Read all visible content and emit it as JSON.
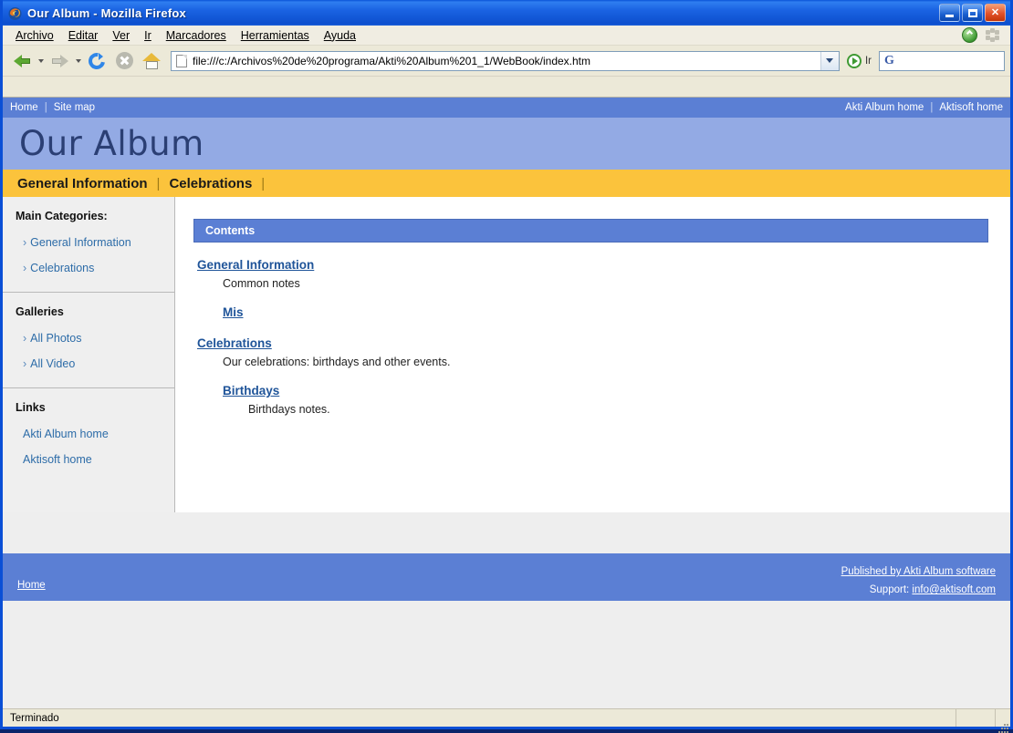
{
  "browser": {
    "title": "Our Album - Mozilla Firefox",
    "app_icon": "firefox-icon",
    "window_buttons": {
      "minimize": "minimize-button",
      "maximize": "maximize-button",
      "close": "close-button"
    },
    "menu": [
      "Archivo",
      "Editar",
      "Ver",
      "Ir",
      "Marcadores",
      "Herramientas",
      "Ayuda"
    ],
    "toolbar": {
      "back": "back-button",
      "forward": "forward-button",
      "reload": "reload-button",
      "stop": "stop-button",
      "home": "home-button",
      "url": "file:///c:/Archivos%20de%20programa/Akti%20Album%201_1/WebBook/index.htm",
      "go_label": "Ir",
      "search_logo": "G",
      "search_value": ""
    },
    "status": "Terminado"
  },
  "page": {
    "topnav": {
      "left": [
        {
          "label": "Home"
        },
        {
          "label": "Site map"
        }
      ],
      "right": [
        {
          "label": "Akti Album home"
        },
        {
          "label": "Aktisoft home"
        }
      ],
      "separator": "|"
    },
    "banner_title": "Our Album",
    "tabs": [
      {
        "label": "General Information"
      },
      {
        "label": "Celebrations"
      }
    ],
    "tab_separator": "|",
    "sidebar": {
      "blocks": [
        {
          "title": "Main Categories:",
          "items": [
            {
              "label": "General Information",
              "chevron": "›"
            },
            {
              "label": "Celebrations",
              "chevron": "›"
            }
          ]
        },
        {
          "title": "Galleries",
          "items": [
            {
              "label": "All Photos",
              "chevron": "›"
            },
            {
              "label": "All Video",
              "chevron": "›"
            }
          ]
        },
        {
          "title": "Links",
          "items": [
            {
              "label": "Akti Album home",
              "chevron": ""
            },
            {
              "label": "Aktisoft home",
              "chevron": ""
            }
          ]
        }
      ]
    },
    "contents": {
      "header": "Contents",
      "entries": [
        {
          "link": "General Information",
          "note": "Common notes",
          "children": [
            {
              "link": "Mis",
              "note": ""
            }
          ]
        },
        {
          "link": "Celebrations",
          "note": "Our celebrations: birthdays and other events.",
          "children": [
            {
              "link": "Birthdays",
              "note": "Birthdays notes."
            }
          ]
        }
      ]
    },
    "footer": {
      "home": "Home",
      "published": "Published by Akti Album software",
      "support_label": "Support:",
      "support_email": "info@aktisoft.com"
    }
  },
  "colors": {
    "titlebar": "#1a63e2",
    "page_blue": "#5b7fd4",
    "banner_blue": "#93aae4",
    "tab_orange": "#fbc33c",
    "link_blue": "#1f5499",
    "sidebar_bg": "#efefef"
  }
}
